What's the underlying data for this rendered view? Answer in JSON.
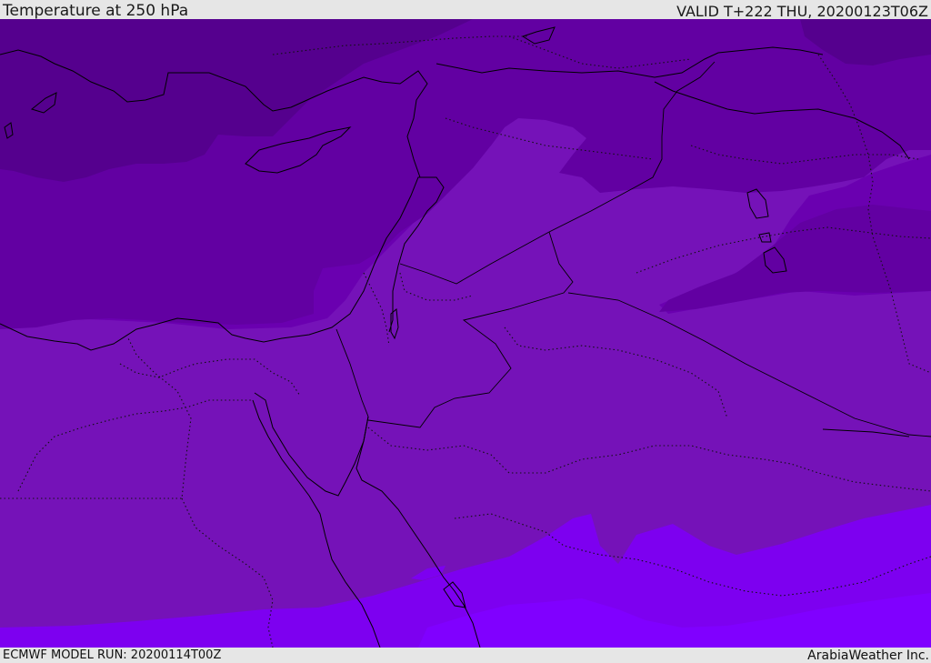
{
  "header": {
    "title": "Temperature at 250 hPa",
    "valid": "VALID T+222 THU, 20200123T06Z"
  },
  "footer": {
    "model_run": "ECMWF MODEL RUN: 20200114T00Z",
    "credit": "ArabiaWeather Inc."
  },
  "colors": {
    "band_darkest": "#55008e",
    "band_dark": "#6200a2",
    "band_mid": "#6a00b0",
    "band_base": "#7512b8",
    "band_light": "#7d00f0",
    "band_lightest": "#8000ff",
    "boundary_lines": "#000000",
    "header_background": "#e6e6e6"
  }
}
